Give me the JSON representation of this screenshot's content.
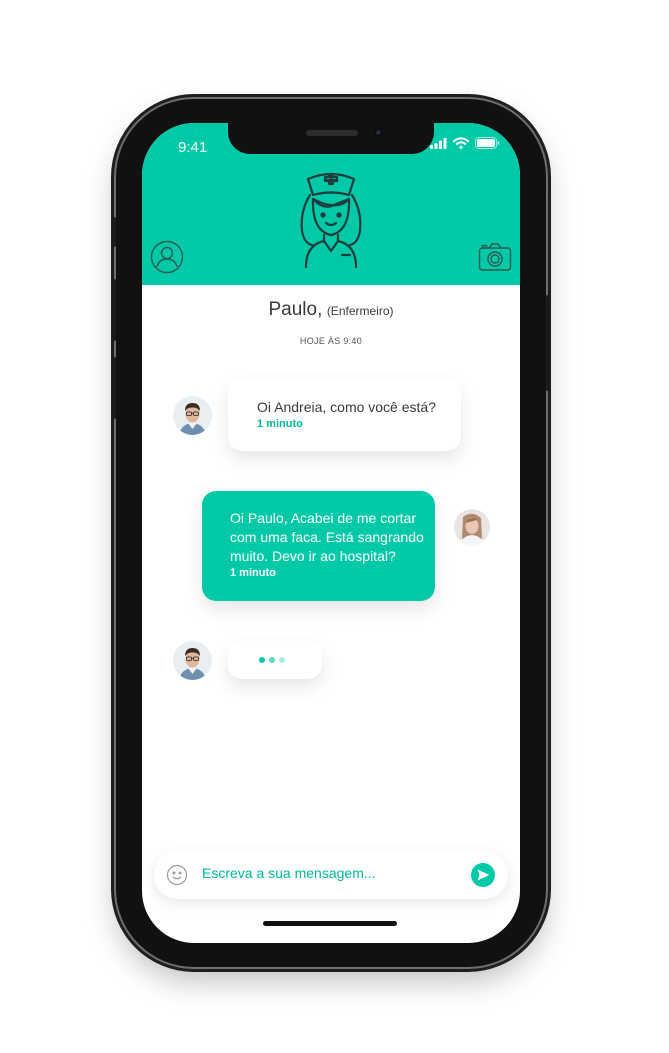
{
  "status_bar": {
    "time": "9:41"
  },
  "header": {
    "contact_name": "Paulo,",
    "contact_role": "(Enfermeiro)",
    "timestamp": "HOJE ÀS 9:40"
  },
  "messages": [
    {
      "direction": "incoming",
      "text": "Oi Andreia, como você está?",
      "time": "1 minuto"
    },
    {
      "direction": "outgoing",
      "lines": [
        "Oi Paulo, Acabei de me cortar",
        "com uma faca. Está sangrando",
        "muito. Devo ir ao hospital?"
      ],
      "time": "1 minuto"
    }
  ],
  "typing": {
    "dot_colors": [
      "#00c9a7",
      "#5fd9c4",
      "#a8ece0"
    ]
  },
  "composer": {
    "placeholder": "Escreva a sua mensagem..."
  },
  "colors": {
    "accent": "#00c9a7",
    "accent_text": "#00b89a",
    "text": "#3a3a3a"
  },
  "icons": [
    "nurse-mascot-icon",
    "profile-icon",
    "camera-icon",
    "emoji-icon",
    "send-icon",
    "signal-icon",
    "wifi-icon",
    "battery-icon"
  ]
}
